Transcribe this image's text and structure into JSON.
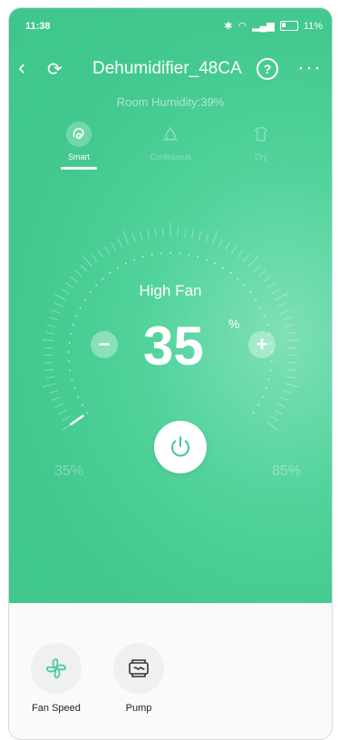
{
  "status_bar": {
    "time": "11:38",
    "battery": "11%"
  },
  "header": {
    "title": "Dehumidifier_48CA",
    "help": "?",
    "more": "···"
  },
  "room_humidity": "Room Humidity:39%",
  "modes": [
    {
      "label": "Smart",
      "icon": "smart-icon",
      "active": true
    },
    {
      "label": "Continuous",
      "icon": "continuous-icon",
      "active": false
    },
    {
      "label": "Dry",
      "icon": "dry-icon",
      "active": false
    }
  ],
  "dial": {
    "fan_label": "High Fan",
    "value": "35",
    "unit": "%",
    "minus": "−",
    "plus": "+",
    "min_label": "35%",
    "max_label": "85%",
    "level": 0.0
  },
  "functions": [
    {
      "label": "Fan Speed",
      "icon": "fan-icon"
    },
    {
      "label": "Pump",
      "icon": "pump-icon"
    }
  ],
  "colors": {
    "accent": "#43c98f",
    "fan_icon": "#4fc8a0"
  }
}
